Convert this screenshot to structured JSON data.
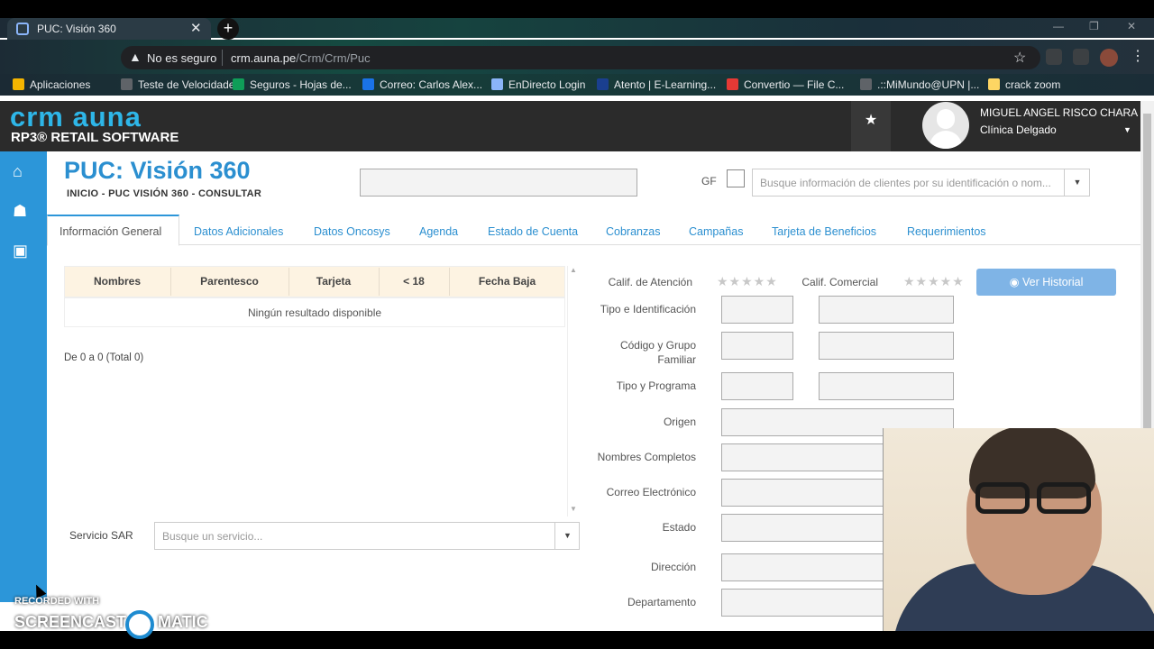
{
  "browser": {
    "tab_title": "PUC: Visión 360",
    "security": "No es seguro",
    "url_host": "crm.auna.pe",
    "url_path": "/Crm/Crm/Puc",
    "bookmarks": [
      {
        "label": "Aplicaciones",
        "color": "#f4b400"
      },
      {
        "label": "Teste de Velocidade...",
        "color": "#5f6368"
      },
      {
        "label": "Seguros - Hojas de...",
        "color": "#0f9d58"
      },
      {
        "label": "Correo: Carlos Alex...",
        "color": "#1a73e8"
      },
      {
        "label": "EnDirecto Login",
        "color": "#8ab4f8"
      },
      {
        "label": "Atento | E-Learning...",
        "color": "#1a3f8f"
      },
      {
        "label": "Convertio — File C...",
        "color": "#e53935"
      },
      {
        "label": ".::MiMundo@UPN |...",
        "color": "#5f6368"
      },
      {
        "label": "crack zoom",
        "color": "#fdd663"
      }
    ]
  },
  "app": {
    "logo_top": "crm auna",
    "logo_bottom": "RP3® RETAIL SOFTWARE",
    "user_name": "MIGUEL ANGEL RISCO CHARA",
    "user_org": "Clínica Delgado",
    "accent": "#2c96d9"
  },
  "page": {
    "title": "PUC: Visión 360",
    "breadcrumb": "INICIO  -  PUC VISIÓN 360  -  CONSULTAR",
    "gf_label": "GF",
    "search_placeholder": "Busque información de clientes por su identificación o nom...",
    "tabs": [
      "Información General",
      "Datos Adicionales",
      "Datos Oncosys",
      "Agenda",
      "Estado de Cuenta",
      "Cobranzas",
      "Campañas",
      "Tarjeta de Beneficios",
      "Requerimientos"
    ]
  },
  "table": {
    "headers": [
      "Nombres",
      "Parentesco",
      "Tarjeta",
      "< 18",
      "Fecha Baja"
    ],
    "empty": "Ningún resultado disponible",
    "paging": "De 0 a 0 (Total 0)"
  },
  "sar": {
    "label": "Servicio SAR",
    "placeholder": "Busque un servicio..."
  },
  "form": {
    "calif_atencion": "Calif. de Atención",
    "calif_comercial": "Calif. Comercial",
    "stars": "★★★★★",
    "ver_historial": "Ver Historial",
    "tipo_id": "Tipo e Identificación",
    "codigo": "Código y Grupo Familiar",
    "tipo_programa": "Tipo y Programa",
    "origen": "Origen",
    "nombres": "Nombres Completos",
    "correo": "Correo Electrónico",
    "estado": "Estado",
    "direccion": "Dirección",
    "departamento": "Departamento"
  },
  "watermark": {
    "line1": "RECORDED WITH",
    "line2": "SCREENCAST",
    "line3": "MATIC"
  }
}
